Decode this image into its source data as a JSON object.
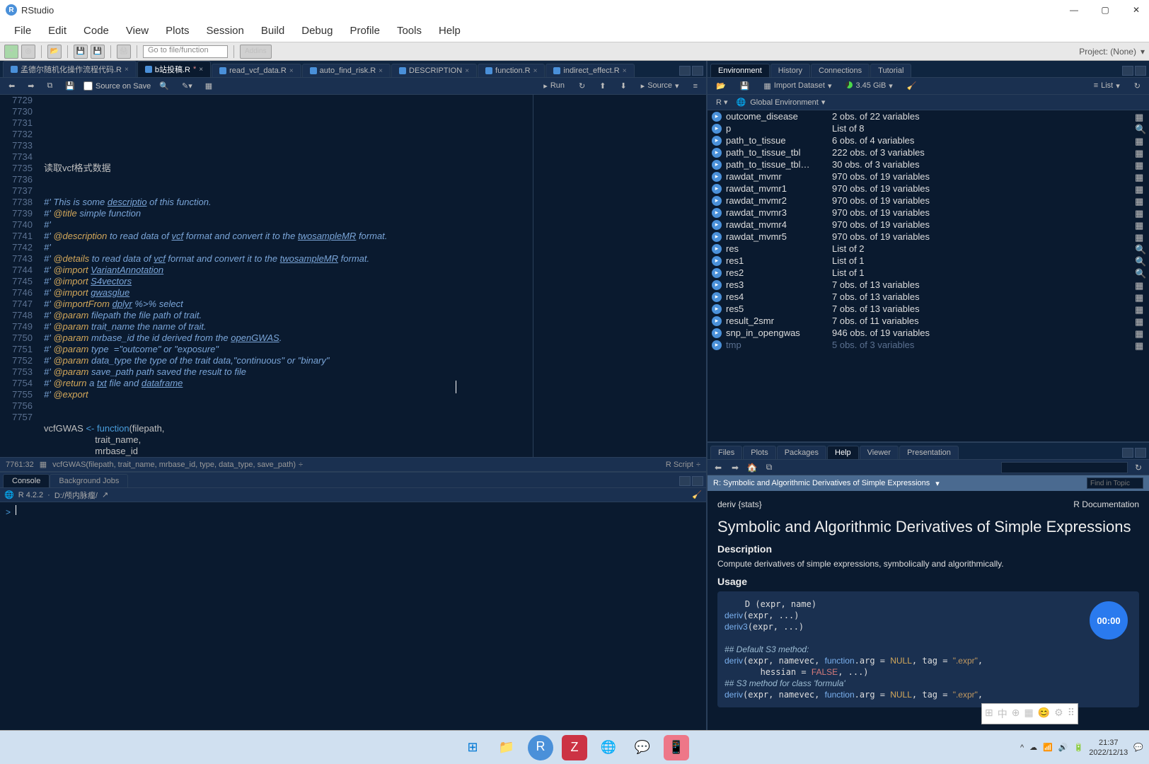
{
  "app": {
    "title": "RStudio"
  },
  "menubar": [
    "File",
    "Edit",
    "Code",
    "View",
    "Plots",
    "Session",
    "Build",
    "Debug",
    "Profile",
    "Tools",
    "Help"
  ],
  "toolbar": {
    "search_placeholder": "Go to file/function",
    "addins": "Addins",
    "project": "Project: (None)"
  },
  "source": {
    "tabs": [
      {
        "label": "孟德尔随机化操作流程代码.R",
        "active": false
      },
      {
        "label": "b站投稿.R",
        "active": true,
        "dirty": true
      },
      {
        "label": "read_vcf_data.R",
        "active": false
      },
      {
        "label": "auto_find_risk.R",
        "active": false
      },
      {
        "label": "DESCRIPTION",
        "active": false
      },
      {
        "label": "function.R",
        "active": false
      },
      {
        "label": "indirect_effect.R",
        "active": false
      }
    ],
    "toolbar": {
      "source_on_save": "Source on Save",
      "run": "Run",
      "source": "Source"
    },
    "lines_start": 7729,
    "code_lines": [
      "",
      "",
      "",
      "读取vcf格式数据",
      "",
      "",
      "#' This is some descriptio of this function.",
      "#' @title simple function",
      "#'",
      "#' @description to read data of vcf format and convert it to the twosampleMR format.",
      "#'",
      "#' @details to read data of vcf format and convert it to the twosampleMR format.",
      "#' @import VariantAnnotation",
      "#' @import S4vectors",
      "#' @import gwasglue",
      "#' @importFrom dplyr %>% select",
      "#' @param filepath the file path of trait.",
      "#' @param trait_name the name of trait.",
      "#' @param mrbase_id the id derived from the openGWAS.",
      "#' @param type  =\"outcome\" or \"exposure\"",
      "#' @param data_type the type of the trait data,\"continuous\" or \"binary\"",
      "#' @param save_path path saved the result to file",
      "#' @return a txt file and dataframe",
      "#' @export",
      "",
      "",
      "vcfGWAS <- function(filepath,",
      "                    trait_name,",
      "                    mrbase_id"
    ],
    "status": {
      "pos": "7761:32",
      "context": "vcfGWAS(filepath, trait_name, mrbase_id, type, data_type, save_path)",
      "lang": "R Script"
    }
  },
  "console": {
    "tabs": [
      "Console",
      "Background Jobs"
    ],
    "version": "R 4.2.2",
    "wd": "D:/颅内脉瘤/",
    "prompt": ">"
  },
  "env": {
    "tabs": [
      "Environment",
      "History",
      "Connections",
      "Tutorial"
    ],
    "toolbar": {
      "import": "Import Dataset",
      "mem": "3.45 GiB",
      "list": "List"
    },
    "scope": "Global Environment",
    "r_label": "R",
    "rows": [
      {
        "name": "outcome_disease",
        "val": "2 obs. of 22 variables",
        "expand": true
      },
      {
        "name": "p",
        "val": "List of  8",
        "expand": true,
        "mag": true
      },
      {
        "name": "path_to_tissue",
        "val": "6 obs. of 4 variables",
        "expand": true
      },
      {
        "name": "path_to_tissue_tbl",
        "val": "222 obs. of 3 variables",
        "expand": true
      },
      {
        "name": "path_to_tissue_tbl…",
        "val": "30 obs. of 3 variables",
        "expand": true
      },
      {
        "name": "rawdat_mvmr",
        "val": "970 obs. of 19 variables",
        "expand": true
      },
      {
        "name": "rawdat_mvmr1",
        "val": "970 obs. of 19 variables",
        "expand": true
      },
      {
        "name": "rawdat_mvmr2",
        "val": "970 obs. of 19 variables",
        "expand": true
      },
      {
        "name": "rawdat_mvmr3",
        "val": "970 obs. of 19 variables",
        "expand": true
      },
      {
        "name": "rawdat_mvmr4",
        "val": "970 obs. of 19 variables",
        "expand": true
      },
      {
        "name": "rawdat_mvmr5",
        "val": "970 obs. of 19 variables",
        "expand": true
      },
      {
        "name": "res",
        "val": "List of  2",
        "expand": true,
        "mag": true
      },
      {
        "name": "res1",
        "val": "List of  1",
        "expand": true,
        "mag": true
      },
      {
        "name": "res2",
        "val": "List of  1",
        "expand": true,
        "mag": true
      },
      {
        "name": "res3",
        "val": "7 obs. of 13 variables",
        "expand": true
      },
      {
        "name": "res4",
        "val": "7 obs. of 13 variables",
        "expand": true
      },
      {
        "name": "res5",
        "val": "7 obs. of 13 variables",
        "expand": true
      },
      {
        "name": "result_2smr",
        "val": "7 obs. of 11 variables",
        "expand": true
      },
      {
        "name": "snp_in_opengwas",
        "val": "946 obs. of 19 variables",
        "expand": true
      },
      {
        "name": "tmp",
        "val": "5 obs. of 3 variables",
        "expand": true,
        "dim": true
      }
    ]
  },
  "help": {
    "tabs": [
      "Files",
      "Plots",
      "Packages",
      "Help",
      "Viewer",
      "Presentation"
    ],
    "topic": "R: Symbolic and Algorithmic Derivatives of Simple Expressions",
    "find_placeholder": "Find in Topic",
    "name": "deriv {stats}",
    "doc_label": "R Documentation",
    "title": "Symbolic and Algorithmic Derivatives of Simple Expressions",
    "desc_h": "Description",
    "desc_p": "Compute derivatives of simple expressions, symbolically and algorithmically.",
    "usage_h": "Usage"
  },
  "timer": "00:00",
  "taskbar": {
    "time": "21:37",
    "date": "2022/12/13"
  }
}
